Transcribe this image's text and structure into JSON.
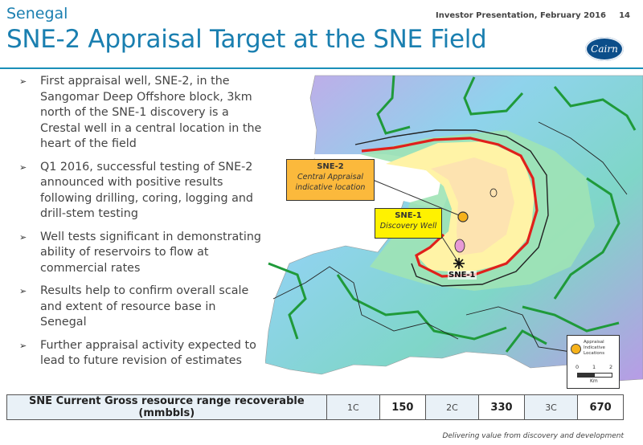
{
  "header": {
    "subtitle": "Senegal",
    "title": "SNE-2 Appraisal Target at the SNE Field",
    "meta": "Investor Presentation, February 2016",
    "page_number": "14",
    "logo_text": "Cairn"
  },
  "bullets": [
    {
      "text": "First appraisal well, SNE-2, in the Sangomar Deep Offshore block, 3km north of the SNE-1 discovery is a Crestal well in a central location in the heart of the field"
    },
    {
      "text": "Q1 2016, successful testing of SNE-2 announced with positive results following drilling, coring, logging and drill-stem testing"
    },
    {
      "text": "Well tests significant in demonstrating ability of reservoirs to flow at commercial rates"
    },
    {
      "text": "Results help to confirm overall scale and extent of resource base in Senegal"
    },
    {
      "text": "Further appraisal activity expected to lead to future revision of estimates"
    }
  ],
  "map": {
    "callouts": {
      "sne2_title": "SNE-2",
      "sne2_line1": "Central Appraisal",
      "sne2_line2": "indicative location",
      "sne1_title": "SNE-1",
      "sne1_line1": "Discovery Well"
    },
    "well_label": "SNE-1",
    "legend": {
      "line1": "Appraisal",
      "line2": "Indicative",
      "line3": "Locations",
      "scale_0": "0",
      "scale_1": "1",
      "scale_2": "2",
      "unit": "Km"
    },
    "colors": {
      "appraisal_marker": "#f6b21b",
      "boundary_red": "#e0201b",
      "contour_green": "#1f9a3a"
    }
  },
  "resource_table": {
    "label": "SNE Current Gross resource range recoverable (mmbbls)",
    "cells": [
      {
        "class": "1C",
        "value": "150"
      },
      {
        "class": "2C",
        "value": "330"
      },
      {
        "class": "3C",
        "value": "670"
      }
    ]
  },
  "footer": {
    "tagline": "Delivering value from discovery and development"
  }
}
